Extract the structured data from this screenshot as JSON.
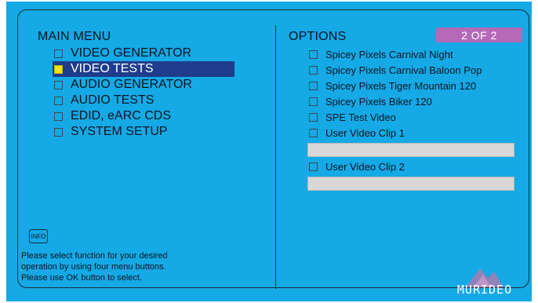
{
  "main_menu": {
    "title": "MAIN MENU",
    "items": [
      {
        "label": "VIDEO GENERATOR",
        "selected": false
      },
      {
        "label": "VIDEO TESTS",
        "selected": true
      },
      {
        "label": "AUDIO GENERATOR",
        "selected": false
      },
      {
        "label": "AUDIO TESTS",
        "selected": false
      },
      {
        "label": "EDID, eARC CDS",
        "selected": false
      },
      {
        "label": "SYSTEM SETUP",
        "selected": false
      }
    ]
  },
  "options": {
    "title": "OPTIONS",
    "page_badge": "2 OF 2",
    "items": [
      {
        "label": "Spicey Pixels Carnival Night"
      },
      {
        "label": "Spicey Pixels Carnival Baloon Pop"
      },
      {
        "label": "Spicey Pixels Tiger Mountain 120"
      },
      {
        "label": "Spicey Pixels Biker 120"
      },
      {
        "label": "SPE Test Video"
      },
      {
        "label": "User Video Clip 1",
        "field_value": ""
      },
      {
        "label": "User Video Clip 2",
        "field_value": ""
      }
    ]
  },
  "info": {
    "button_label": "INFO",
    "help_lines": [
      "Please select function for your desired",
      "operation by using four menu buttons.",
      "Please use OK button to select."
    ]
  },
  "brand": {
    "logo_text": "MURIDEO",
    "logo_icon": "mountain-logo-icon"
  },
  "colors": {
    "background": "#15a9e5",
    "selection": "#1f3d8c",
    "selected_checkbox": "#f0e020",
    "badge": "#b46ab8"
  }
}
